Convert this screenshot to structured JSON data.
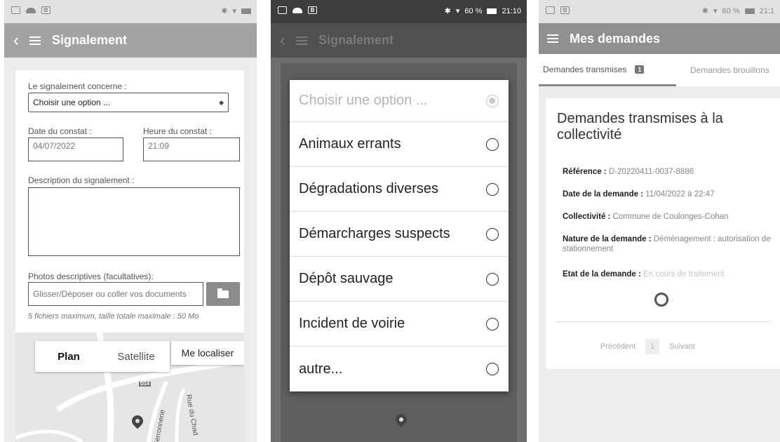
{
  "screen1": {
    "status_time": "",
    "title": "Signalement",
    "form": {
      "concern_label": "Le signalement concerne :",
      "concern_value": "Choisir une option ...",
      "date_label": "Date du constat :",
      "date_value": "04/07/2022",
      "time_label": "Heure du constat :",
      "time_value": "21:09",
      "description_label": "Description du signalement :",
      "photos_label": "Photos descriptives (facultatives):",
      "photos_placeholder": "Glisser/Déposer ou coller vos documents",
      "photos_hint": "5 fichiers maximum, taille totale maximale : 50 Mo"
    },
    "map": {
      "tab_plan": "Plan",
      "tab_satellite": "Satellite",
      "locate_label": "Me localiser",
      "road_badge": "D14",
      "road_label_1": "Rue du Chad",
      "road_label_2": "Ferronnerie"
    }
  },
  "screen2": {
    "status_text": "60 %",
    "status_time": "21:10",
    "title": "Signalement",
    "options": [
      "Choisir une option ...",
      "Animaux errants",
      "Dégradations diverses",
      "Démarcharges suspects",
      "Dépôt sauvage",
      "Incident de voirie",
      "autre..."
    ]
  },
  "screen3": {
    "status_text": "60 %",
    "status_time": "21:1",
    "title": "Mes demandes",
    "tab_transmitted": "Demandes transmises",
    "tab_transmitted_count": "1",
    "tab_drafts": "Demandes brouillons",
    "card_title": "Demandes transmises à la collectivité",
    "reference_label": "Référence :",
    "reference_value": "D-20220411-0037-8886",
    "date_label": "Date de la demande :",
    "date_value": "11/04/2022 à 22:47",
    "collectivity_label": "Collectivité :",
    "collectivity_value": "Commune de Coulonges-Cohan",
    "nature_label": "Nature de la demande :",
    "nature_value": "Déménagement : autorisation de stationnement",
    "state_label": "Etat de la demande :",
    "state_value": "En cours de traitement",
    "pager_prev": "Précédent",
    "pager_current": "1",
    "pager_next": "Suivant"
  }
}
